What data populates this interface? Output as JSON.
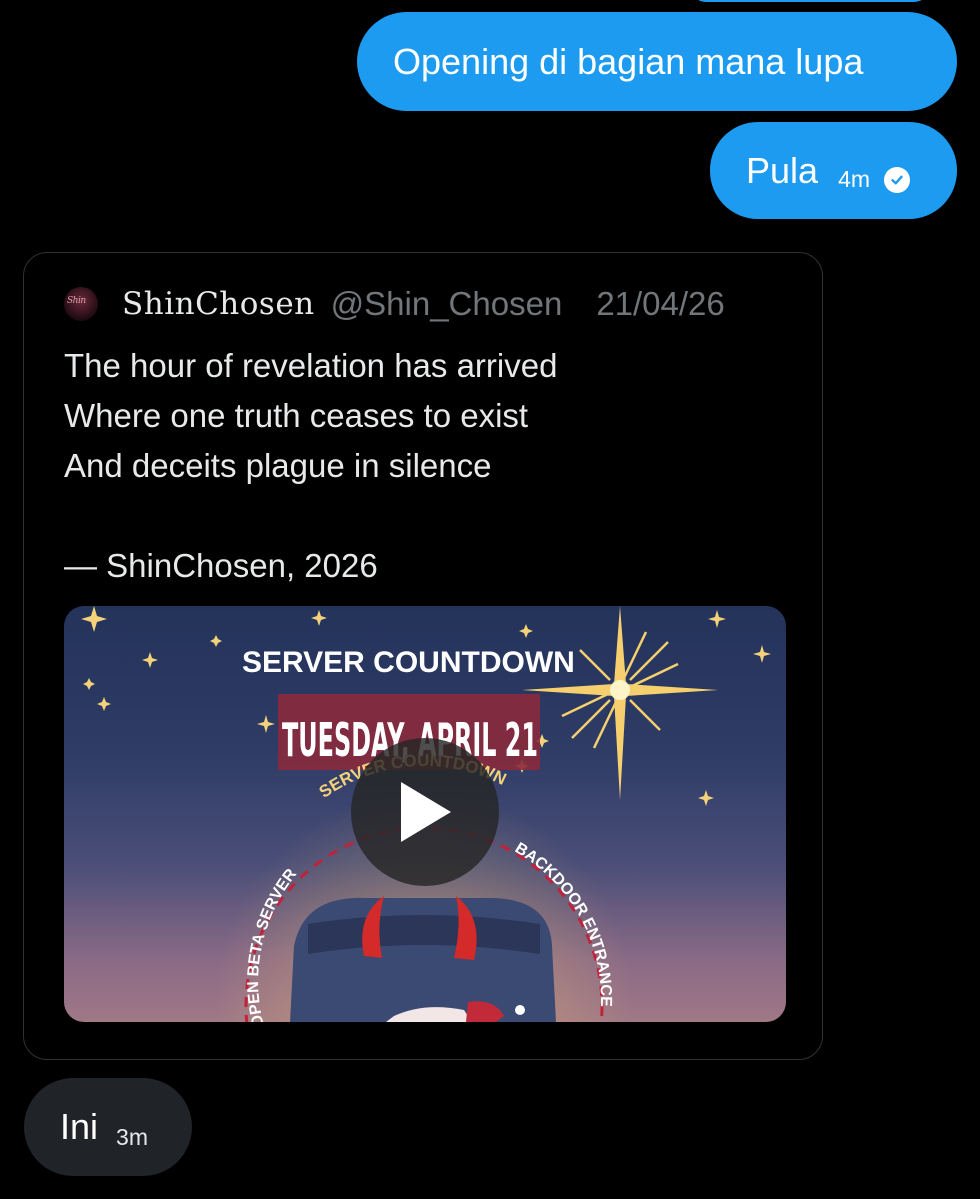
{
  "conversation": {
    "messages": [
      {
        "text": "Opening di bagian mana lupa"
      },
      {
        "text": "Pula",
        "time": "4m",
        "status_icon": "read-check-icon"
      }
    ],
    "quoted_post": {
      "display_name": "ShinChosen",
      "handle": "@Shin_Chosen",
      "date": "21/04/26",
      "lines": [
        "The hour of revelation has arrived",
        "Where one truth ceases to exist",
        "And deceits plague in silence",
        "",
        "— ShinChosen, 2026"
      ],
      "media": {
        "kind": "video",
        "play_icon": "play-icon",
        "poster_texts": {
          "heading": "SERVER COUNTDOWN",
          "date": "TUESDAY, APRIL 21",
          "arc_top": "SERVER COUNTDOWN",
          "arc_left": "OPEN BETA SERVER",
          "arc_right": "BACKDOOR ENTRANCE"
        }
      }
    },
    "reply": {
      "text": "Ini",
      "time": "3m"
    }
  },
  "colors": {
    "outgoing_bubble": "#1d9bf0",
    "incoming_bubble": "#202327",
    "muted_text": "#71767b",
    "background": "#000000"
  }
}
